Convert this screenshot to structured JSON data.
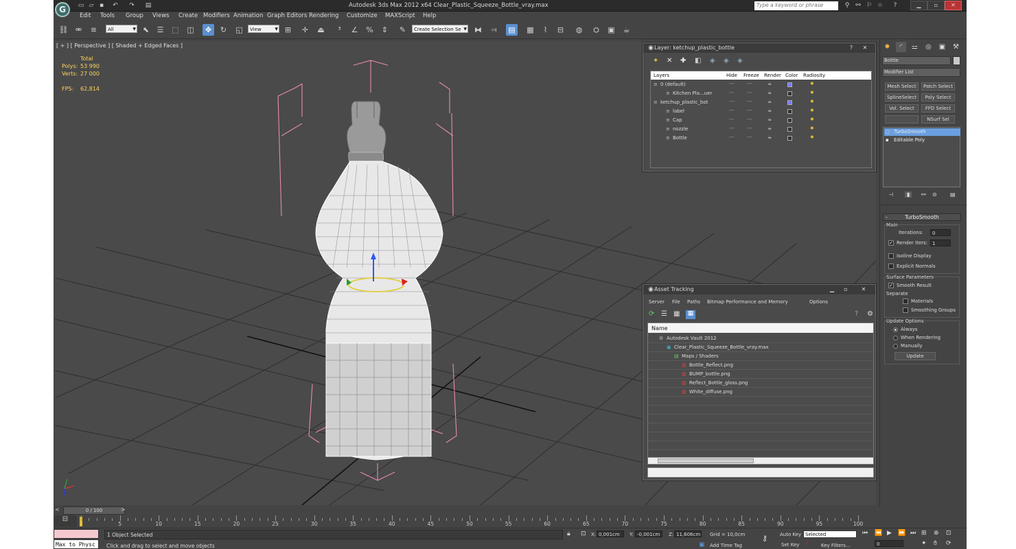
{
  "titlebar": {
    "title": "Autodesk 3ds Max  2012 x64      Clear_Plastic_Squeeze_Bottle_vray.max",
    "search_placeholder": "Type a keyword or phrase"
  },
  "menu": [
    "Edit",
    "Tools",
    "Group",
    "Views",
    "Create",
    "Modifiers",
    "Animation",
    "Graph Editors",
    "Rendering",
    "Customize",
    "MAXScript",
    "Help"
  ],
  "toolbar": {
    "selection_filter": "All",
    "ref_coord": "View",
    "named_selection": "Create Selection Se"
  },
  "viewport": {
    "label": "[ + ] [ Perspective ] [ Shaded + Edged Faces ]",
    "stats": {
      "total_label": "Total",
      "polys_label": "Polys:",
      "polys": "53 990",
      "verts_label": "Verts:",
      "verts": "27 000",
      "fps_label": "FPS:",
      "fps": "62,814"
    }
  },
  "layer_dialog": {
    "title": "Layer: ketchup_plastic_bottle",
    "columns": [
      "Layers",
      "Hide",
      "Freeze",
      "Render",
      "Color",
      "Radiosity"
    ],
    "rows": [
      {
        "name": "0 (default)",
        "level": 0,
        "color": "#7a7aff"
      },
      {
        "name": "Kitchen Pla...uer",
        "level": 1,
        "color": ""
      },
      {
        "name": "ketchup_plastic_bot",
        "level": 0,
        "color": "#7a7aff"
      },
      {
        "name": "label",
        "level": 1,
        "color": ""
      },
      {
        "name": "Cap",
        "level": 1,
        "color": ""
      },
      {
        "name": "nozzle",
        "level": 1,
        "color": ""
      },
      {
        "name": "Bottle",
        "level": 1,
        "color": ""
      }
    ]
  },
  "asset_dialog": {
    "title": "Asset Tracking",
    "menu": [
      "Server",
      "File",
      "Paths",
      "Bitmap Performance and Memory",
      "Options"
    ],
    "column": "Name",
    "rows": [
      {
        "name": "Autodesk Vault 2012",
        "level": 0
      },
      {
        "name": "Clear_Plastic_Squeeze_Bottle_vray.max",
        "level": 1
      },
      {
        "name": "Maps / Shaders",
        "level": 2
      },
      {
        "name": "Bottle_Reflect.png",
        "level": 3
      },
      {
        "name": "BUMP_bottle.png",
        "level": 3
      },
      {
        "name": "Reflect_Bottle_gloss.png",
        "level": 3
      },
      {
        "name": "White_diffuse.png",
        "level": 3
      }
    ]
  },
  "command_panel": {
    "object_name": "Bottle",
    "modifier_list": "Modifier List",
    "buttons": [
      "Mesh Select",
      "Patch Select",
      "SplineSelect",
      "Poly Select",
      "Vol. Select",
      "FFD Select",
      "NSurf Sel"
    ],
    "stack": [
      "TurboSmooth",
      "Editable Poly"
    ],
    "turbosmooth": {
      "title": "TurboSmooth",
      "main": "Main",
      "iterations_label": "Iterations:",
      "iterations": "0",
      "render_iters_label": "Render Iters:",
      "render_iters": "1",
      "isoline": "Isoline Display",
      "explicit": "Explicit Normals",
      "surface": "Surface Parameters",
      "smooth_result": "Smooth Result",
      "separate": "Separate",
      "materials": "Materials",
      "smoothing": "Smoothing Groups",
      "update_options": "Update Options",
      "always": "Always",
      "when_rendering": "When Rendering",
      "manually": "Manually",
      "update_btn": "Update"
    }
  },
  "timeline": {
    "frame": "0 / 100",
    "ticks": [
      "5",
      "10",
      "15",
      "20",
      "25",
      "30",
      "35",
      "40",
      "45",
      "50",
      "55",
      "60",
      "65",
      "70",
      "75",
      "80",
      "85",
      "90",
      "95",
      "100"
    ]
  },
  "status": {
    "maxscript": "Max to Physc",
    "selected": "1 Object Selected",
    "prompt": "Click and drag to select and move objects",
    "x_label": "X:",
    "x": "0,001cm",
    "y_label": "Y:",
    "y": "-0,001cm",
    "z_label": "Z:",
    "z": "11,606cm",
    "grid": "Grid = 10,0cm",
    "auto_key": "Auto Key",
    "set_key": "Set Key",
    "key_mode": "Selected",
    "key_filters": "Key Filters...",
    "add_time_tag": "Add Time Tag",
    "frame": "0"
  }
}
